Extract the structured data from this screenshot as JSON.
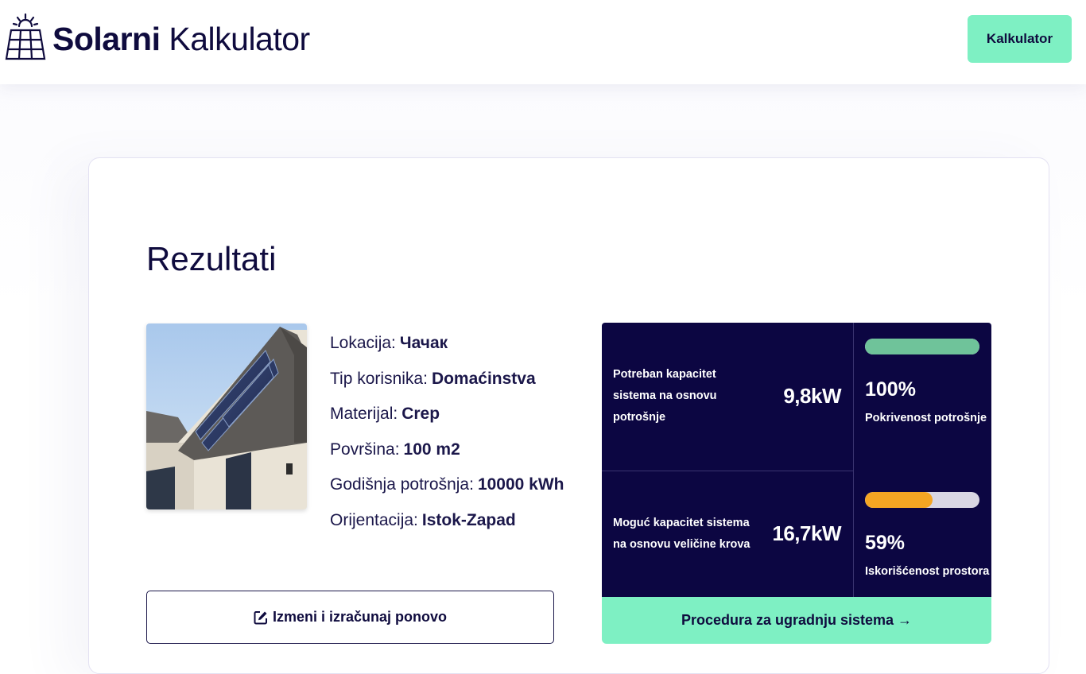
{
  "header": {
    "brand_bold": "Solarni",
    "brand_light": "Kalkulator",
    "nav_button": "Kalkulator"
  },
  "results": {
    "title": "Rezultati",
    "info": [
      {
        "label": "Lokacija:",
        "value": "Чачак"
      },
      {
        "label": "Tip korisnika:",
        "value": "Domaćinstva"
      },
      {
        "label": "Materijal:",
        "value": "Crep"
      },
      {
        "label": "Površina:",
        "value": "100 m2"
      },
      {
        "label": "Godišnja potrošnja:",
        "value": "10000 kWh"
      },
      {
        "label": "Orijentacija:",
        "value": "Istok-Zapad"
      }
    ],
    "edit_button": "Izmeni i izračunaj ponovo"
  },
  "panel": {
    "required": {
      "label_lines": [
        "Potreban kapacitet",
        "sistema na osnovu",
        "potrošnje"
      ],
      "value": "9,8kW"
    },
    "possible": {
      "label_lines": [
        "Moguć kapacitet sistema",
        "na osnovu veličine krova"
      ],
      "value": "16,7kW"
    },
    "coverage": {
      "percent_text": "100%",
      "label": "Pokrivenost potrošnje",
      "fraction": 1.0,
      "color": "#6fc39a"
    },
    "space_usage": {
      "percent_text": "59%",
      "label": "Iskorišćenost prostora",
      "fraction": 0.59,
      "color": "#f5a623"
    },
    "procedure_button": "Procedura za ugradnju sistema →"
  }
}
